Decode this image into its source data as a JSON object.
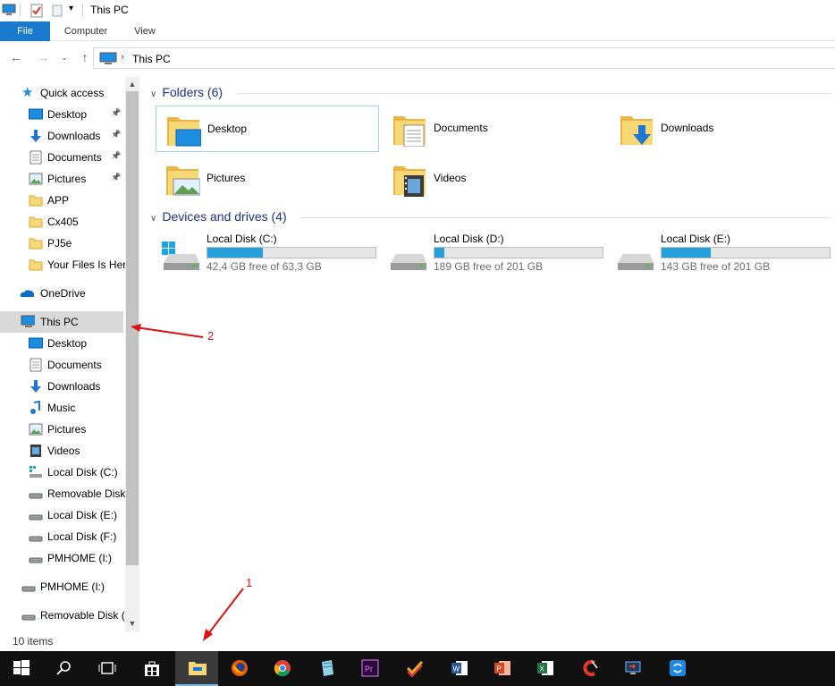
{
  "window": {
    "title": "This PC"
  },
  "ribbon": {
    "tabs": [
      "File",
      "Computer",
      "View"
    ]
  },
  "address": {
    "crumb": "This PC"
  },
  "nav": {
    "quick_access": "Quick access",
    "quick_items": [
      {
        "label": "Desktop",
        "icon": "desktop-icon",
        "pinned": true
      },
      {
        "label": "Downloads",
        "icon": "downloads-icon",
        "pinned": true
      },
      {
        "label": "Documents",
        "icon": "documents-icon",
        "pinned": true
      },
      {
        "label": "Pictures",
        "icon": "pictures-icon",
        "pinned": true
      },
      {
        "label": "APP",
        "icon": "folder-icon",
        "pinned": false
      },
      {
        "label": "Cx405",
        "icon": "folder-icon",
        "pinned": false
      },
      {
        "label": "PJ5e",
        "icon": "folder-icon",
        "pinned": false
      },
      {
        "label": "Your Files Is Here",
        "icon": "folder-icon",
        "pinned": false
      }
    ],
    "onedrive": "OneDrive",
    "this_pc": "This PC",
    "pc_items": [
      {
        "label": "Desktop",
        "icon": "desktop-icon"
      },
      {
        "label": "Documents",
        "icon": "documents-icon"
      },
      {
        "label": "Downloads",
        "icon": "downloads-icon"
      },
      {
        "label": "Music",
        "icon": "music-icon"
      },
      {
        "label": "Pictures",
        "icon": "pictures-icon"
      },
      {
        "label": "Videos",
        "icon": "videos-icon"
      },
      {
        "label": "Local Disk (C:)",
        "icon": "system-drive-icon"
      },
      {
        "label": "Removable Disk",
        "icon": "drive-icon"
      },
      {
        "label": "Local Disk (E:)",
        "icon": "drive-icon"
      },
      {
        "label": "Local Disk (F:)",
        "icon": "drive-icon"
      },
      {
        "label": "PMHOME (I:)",
        "icon": "drive-icon"
      }
    ],
    "root_items": [
      {
        "label": "PMHOME (I:)",
        "icon": "drive-icon"
      },
      {
        "label": "Removable Disk (I",
        "icon": "drive-icon"
      }
    ]
  },
  "content": {
    "folders_header": "Folders (6)",
    "folders": [
      {
        "name": "Desktop",
        "icon": "desktop-folder-icon",
        "selected": true
      },
      {
        "name": "Documents",
        "icon": "documents-folder-icon",
        "selected": false
      },
      {
        "name": "Downloads",
        "icon": "downloads-folder-icon",
        "selected": false
      },
      {
        "name": "Pictures",
        "icon": "pictures-folder-icon",
        "selected": false
      },
      {
        "name": "Videos",
        "icon": "videos-folder-icon",
        "selected": false
      }
    ],
    "drives_header": "Devices and drives (4)",
    "drives": [
      {
        "name": "Local Disk (C:)",
        "free": "42,4 GB free of 63,3 GB",
        "used_fraction": 0.33,
        "system": true
      },
      {
        "name": "Local Disk (D:)",
        "free": "189 GB free of 201 GB",
        "used_fraction": 0.06,
        "system": false
      },
      {
        "name": "Local Disk (E:)",
        "free": "143 GB free of 201 GB",
        "used_fraction": 0.29,
        "system": false
      }
    ]
  },
  "status": {
    "items": "10 items"
  },
  "taskbar": {
    "apps": [
      "start-icon",
      "search-icon",
      "task-view-icon",
      "store-icon",
      "file-explorer-icon",
      "firefox-icon",
      "chrome-icon",
      "notepad-icon",
      "premiere-icon",
      "checklist-icon",
      "word-icon",
      "powerpoint-icon",
      "excel-icon",
      "ccleaner-icon",
      "remote-desktop-icon",
      "sync-icon"
    ]
  },
  "annotations": {
    "label1": "1",
    "label2": "2"
  },
  "colors": {
    "accent": "#1979ca",
    "drive_fill": "#26a0da",
    "annotation": "#dd1111"
  }
}
